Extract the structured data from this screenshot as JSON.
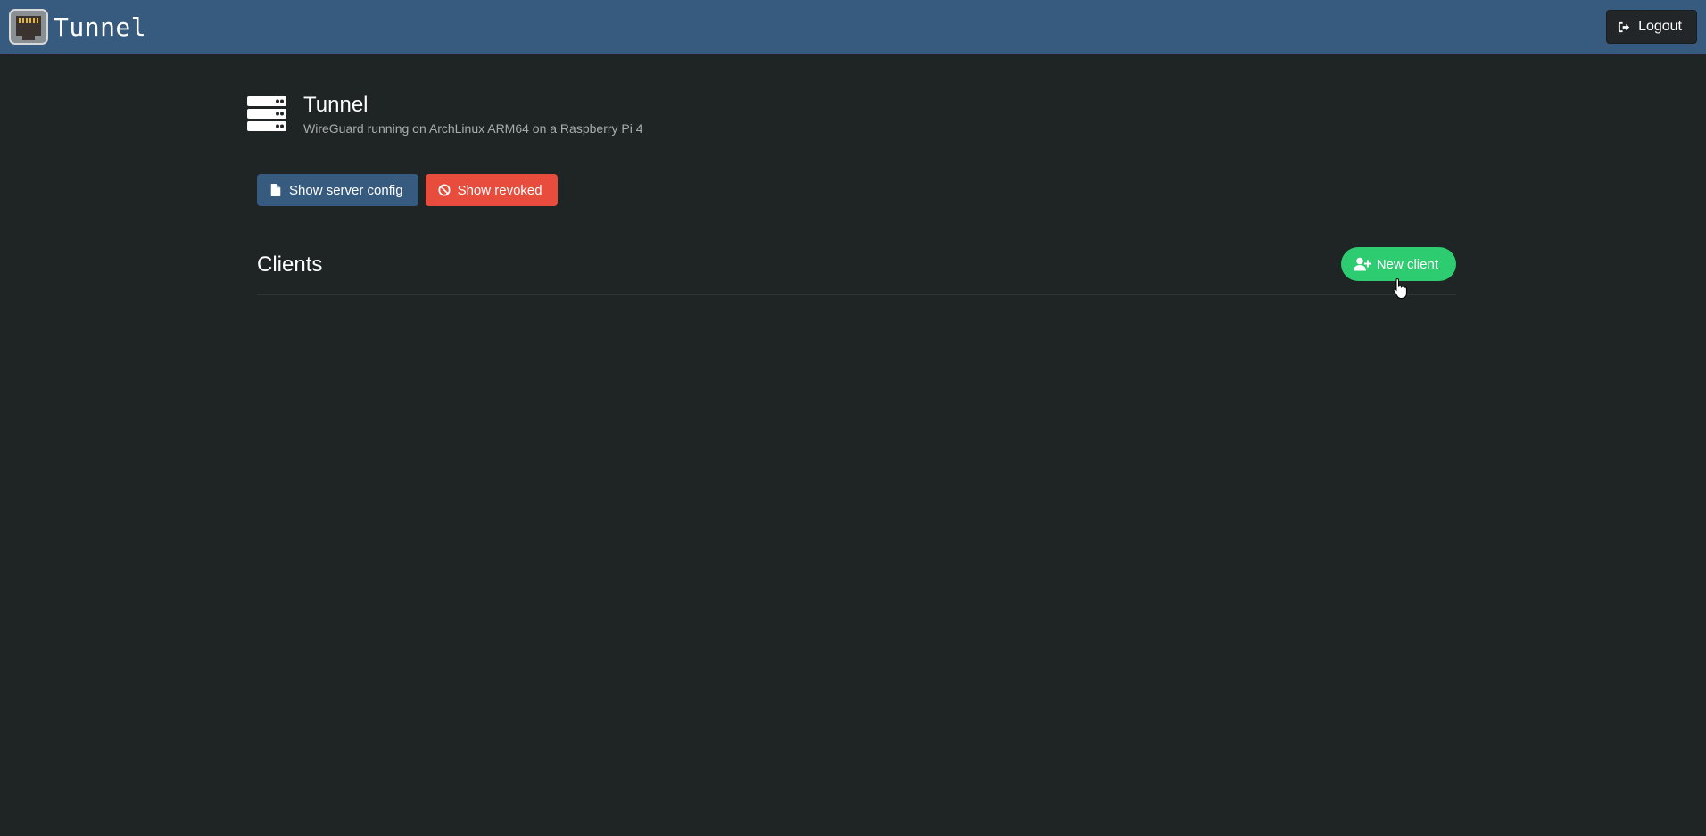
{
  "navbar": {
    "brand_text": "Tunnel",
    "brand_icon": "ethernet-port-icon",
    "logout_label": "Logout",
    "logout_icon": "sign-out-icon",
    "background_color": "#375a7f"
  },
  "server": {
    "icon": "server-icon",
    "title": "Tunnel",
    "subtitle": "WireGuard running on ArchLinux ARM64 on a Raspberry Pi 4"
  },
  "actions": {
    "show_config_label": "Show server config",
    "show_config_icon": "file-icon",
    "show_config_color": "#375a7f",
    "show_revoked_label": "Show revoked",
    "show_revoked_icon": "ban-icon",
    "show_revoked_color": "#e74c3c"
  },
  "clients": {
    "title": "Clients",
    "new_client_label": "New client",
    "new_client_icon": "user-plus-icon",
    "new_client_color": "#2ecc71",
    "items": []
  },
  "colors": {
    "page_background": "#1f2424"
  }
}
